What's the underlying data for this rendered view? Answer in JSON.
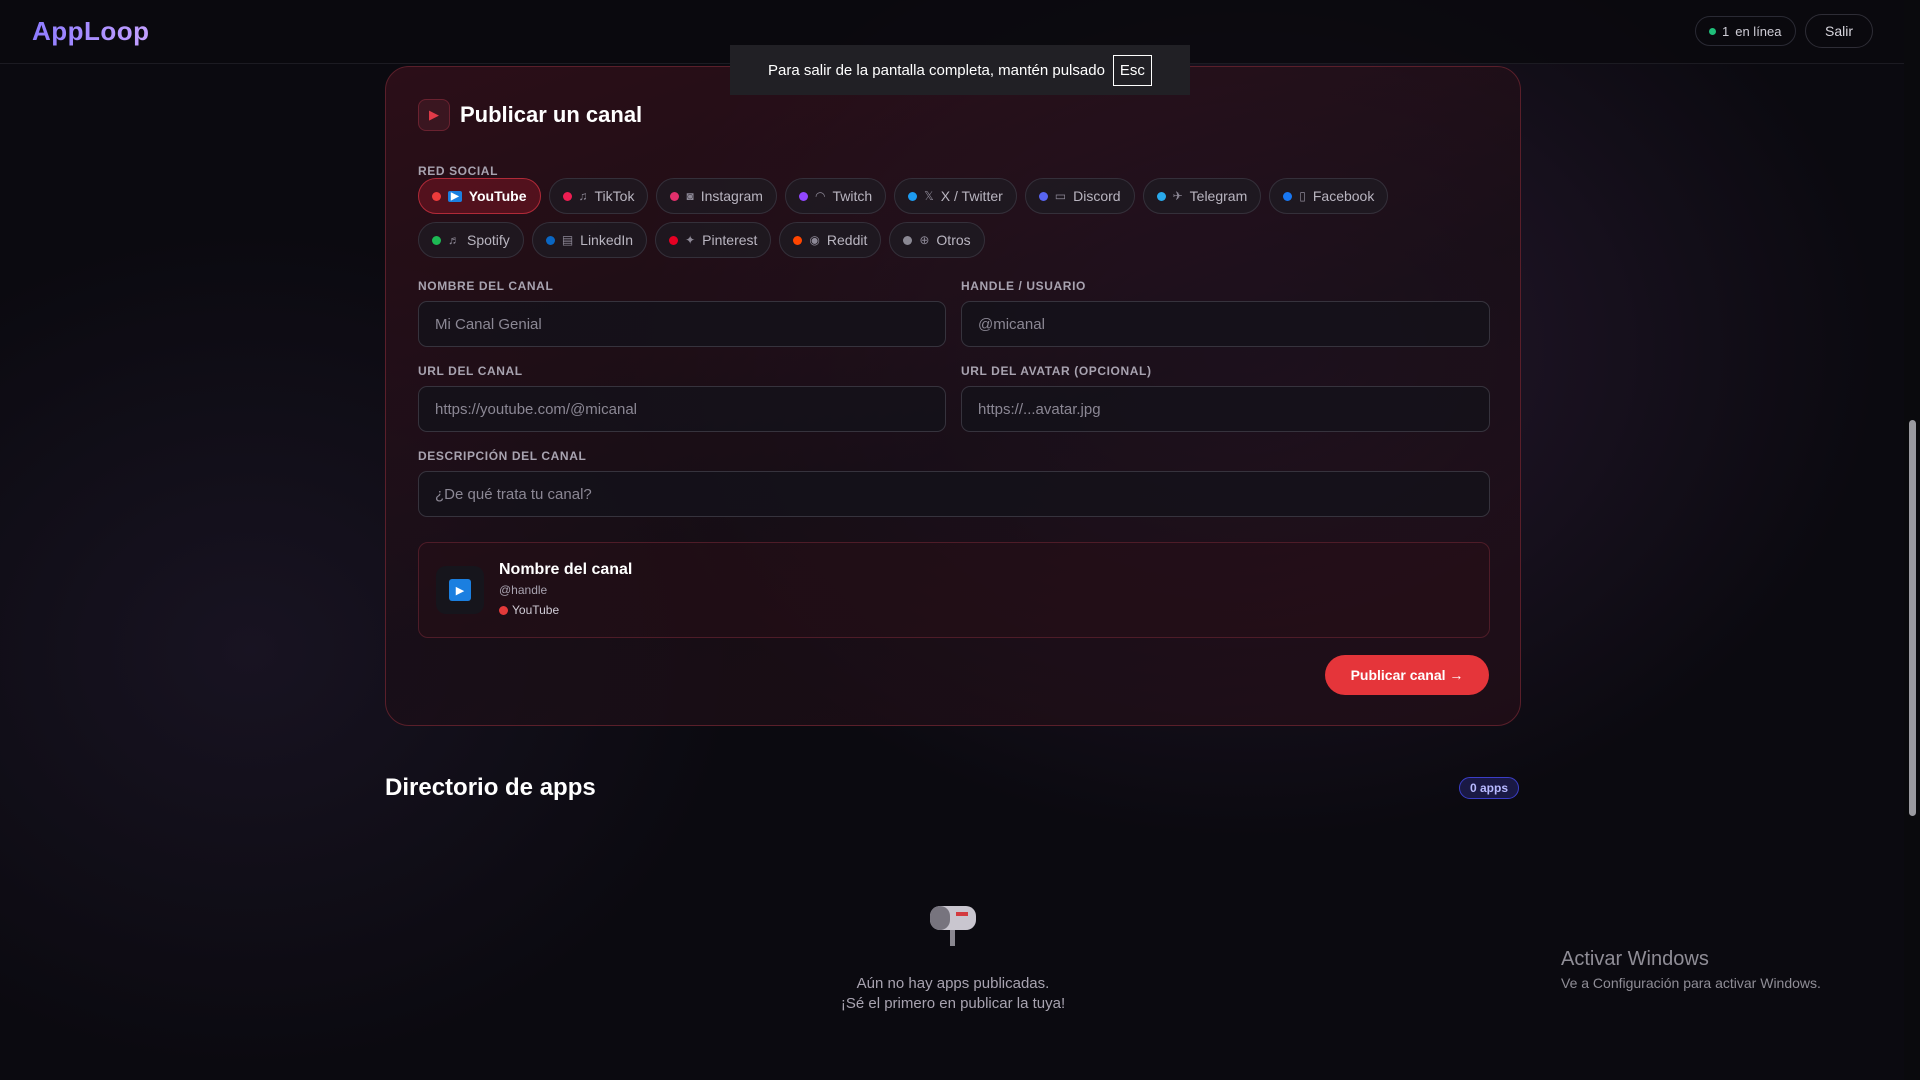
{
  "header": {
    "logo": "AppLoop",
    "online_count": "1",
    "online_label": "en línea",
    "logout_label": "Salir"
  },
  "fullscreen_toast": {
    "text": "Para salir de la pantalla completa, mantén pulsado",
    "key": "Esc"
  },
  "publish": {
    "title": "Publicar un canal",
    "social_label": "Red social",
    "networks": [
      {
        "label": "YouTube",
        "color": "#ef3b3b",
        "icon": "play-icon",
        "selected": true
      },
      {
        "label": "TikTok",
        "color": "#ee1d52",
        "icon": "music-note-icon"
      },
      {
        "label": "Instagram",
        "color": "#e1306c",
        "icon": "camera-icon"
      },
      {
        "label": "Twitch",
        "color": "#9146ff",
        "icon": "game-controller-icon"
      },
      {
        "label": "X / Twitter",
        "color": "#1d9bf0",
        "icon": "x-icon"
      },
      {
        "label": "Discord",
        "color": "#5865f2",
        "icon": "chat-icon"
      },
      {
        "label": "Telegram",
        "color": "#29a9eb",
        "icon": "plane-icon"
      },
      {
        "label": "Facebook",
        "color": "#1877f2",
        "icon": "phone-icon"
      },
      {
        "label": "Spotify",
        "color": "#1db954",
        "icon": "headphones-icon"
      },
      {
        "label": "LinkedIn",
        "color": "#0a66c2",
        "icon": "briefcase-icon"
      },
      {
        "label": "Pinterest",
        "color": "#e60023",
        "icon": "pin-icon"
      },
      {
        "label": "Reddit",
        "color": "#ff4500",
        "icon": "alien-icon"
      },
      {
        "label": "Otros",
        "color": "#8a8893",
        "icon": "globe-icon"
      }
    ],
    "fields": {
      "name_label": "Nombre del canal",
      "name_placeholder": "Mi Canal Genial",
      "handle_label": "Handle / usuario",
      "handle_placeholder": "@micanal",
      "url_label": "URL del canal",
      "url_placeholder": "https://youtube.com/@micanal",
      "avatar_label": "URL del avatar (opcional)",
      "avatar_placeholder": "https://...avatar.jpg",
      "desc_label": "Descripción del canal",
      "desc_placeholder": "¿De qué trata tu canal?"
    },
    "preview": {
      "name": "Nombre del canal",
      "handle": "@handle",
      "network": "YouTube"
    },
    "submit_label": "Publicar canal →"
  },
  "directory": {
    "title": "Directorio de apps",
    "count_badge": "0 apps",
    "empty_line1": "Aún no hay apps publicadas.",
    "empty_line2": "¡Sé el primero en publicar la tuya!"
  },
  "windows_watermark": {
    "line1": "Activar Windows",
    "line2": "Ve a Configuración para activar Windows."
  }
}
